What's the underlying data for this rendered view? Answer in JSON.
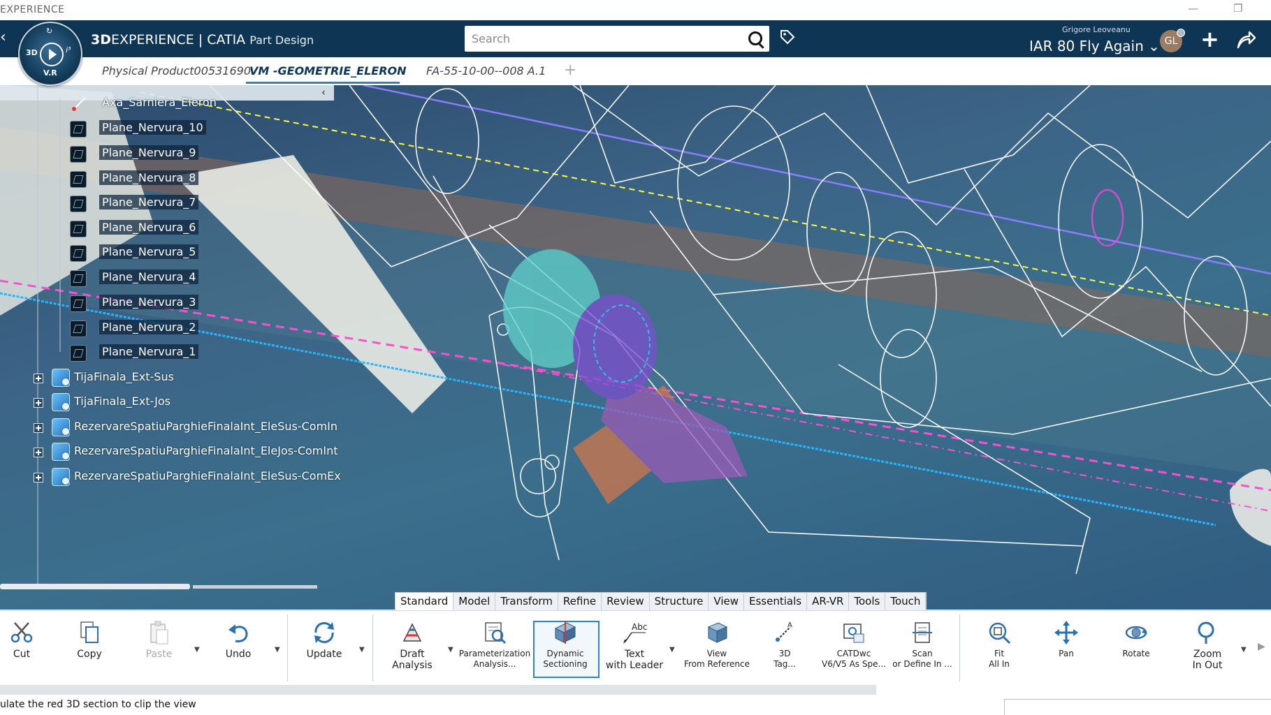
{
  "window": {
    "title": "EXPERIENCE"
  },
  "header": {
    "brand_bold": "3D",
    "brand": "EXPERIENCE",
    "separator": "|",
    "app": "CATIA",
    "workbench": "Part Design",
    "compass": {
      "top": "↻",
      "left": "3D",
      "right": "i³",
      "bottom": "V.R"
    },
    "search": {
      "placeholder": "Search"
    },
    "user": "Grigore Leoveanu",
    "collab_space": "IAR 80 Fly Again",
    "avatar_initials": "GL",
    "accent_color": "#0f3554"
  },
  "tabs": [
    {
      "label": "Physical Product00531690",
      "active": false
    },
    {
      "label": "VM -GEOMETRIE_ELERON",
      "active": true
    },
    {
      "label": "FA-55-10-00--008 A.1",
      "active": false
    }
  ],
  "tree": {
    "collapse_glyph": "‹",
    "planes": [
      "Axa_Sarniera_Eleron",
      "Plane_Nervura_10",
      "Plane_Nervura_9",
      "Plane_Nervura_8",
      "Plane_Nervura_7",
      "Plane_Nervura_6",
      "Plane_Nervura_5",
      "Plane_Nervura_4",
      "Plane_Nervura_3",
      "Plane_Nervura_2",
      "Plane_Nervura_1"
    ],
    "parts": [
      "TijaFinala_Ext-Sus",
      "TijaFinala_Ext-Jos",
      "RezervareSpatiuParghieFinalaInt_EleSus-ComIn",
      "RezervareSpatiuParghieFinalaInt_EleJos-ComInt",
      "RezervareSpatiuParghieFinalaInt_EleSus-ComEx"
    ]
  },
  "command_tabs": [
    "Standard",
    "Model",
    "Transform",
    "Refine",
    "Review",
    "Structure",
    "View",
    "Essentials",
    "AR-VR",
    "Tools",
    "Touch"
  ],
  "commands": {
    "cut": "Cut",
    "copy": "Copy",
    "paste": "Paste",
    "undo": "Undo",
    "update": "Update",
    "draft_1": "Draft",
    "draft_2": "Analysis",
    "param_1": "Parameterization",
    "param_2": "Analysis...",
    "dyn_1": "Dynamic",
    "dyn_2": "Sectioning",
    "text_1": "Text",
    "text_2": "with Leader",
    "view_1": "View",
    "view_2": "From Reference",
    "tag_1": "3D",
    "tag_2": "Tag...",
    "catdwc_1": "CATDwc",
    "catdwc_2": "V6/V5 As Spe...",
    "scan_1": "Scan",
    "scan_2": "or Define In ...",
    "fit_1": "Fit",
    "fit_2": "All In",
    "pan": "Pan",
    "rotate": "Rotate",
    "zoom_1": "Zoom",
    "zoom_2": "In Out"
  },
  "status": {
    "message": "ulate the red 3D section to clip the view"
  }
}
